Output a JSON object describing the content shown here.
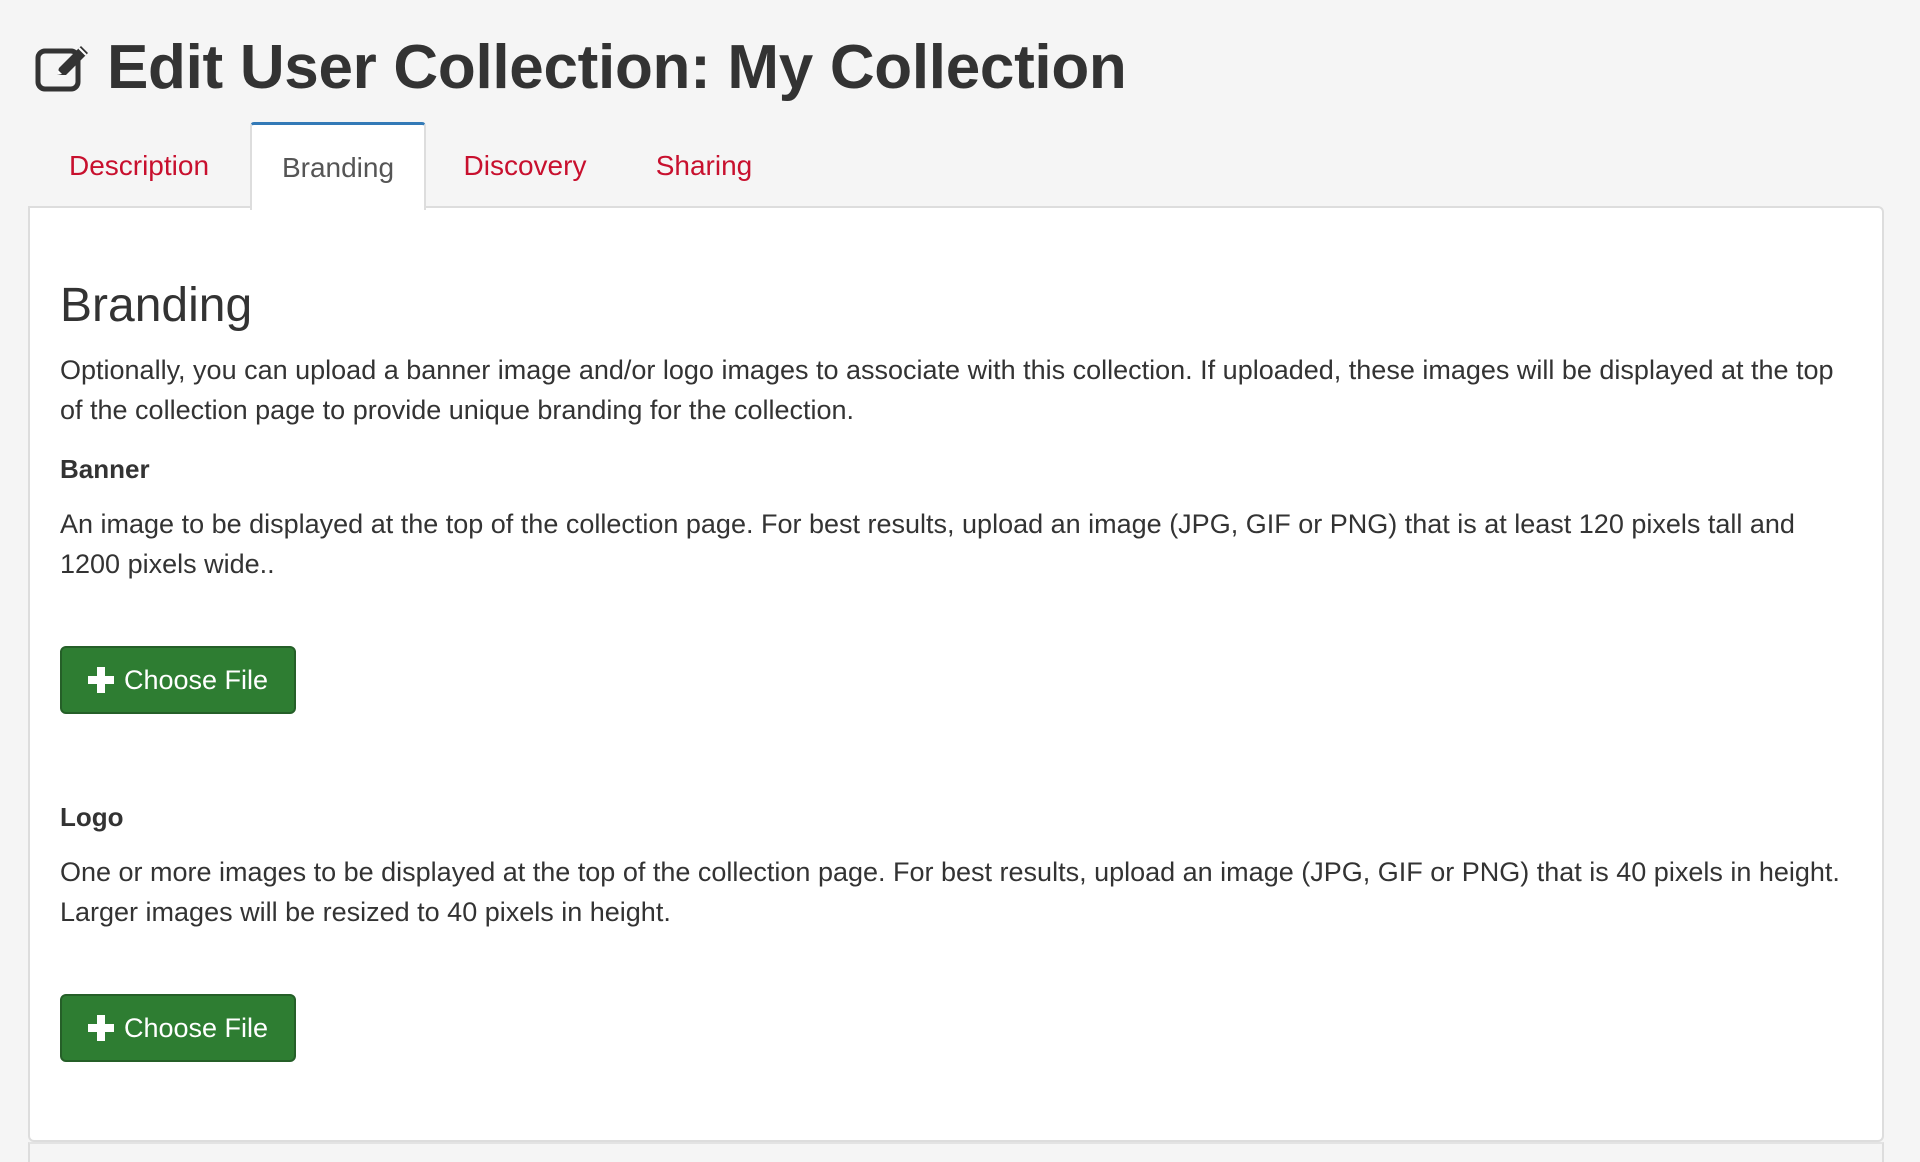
{
  "header": {
    "title": "Edit User Collection: My Collection",
    "icon": "edit-icon"
  },
  "tabs": [
    {
      "label": "Description",
      "active": false
    },
    {
      "label": "Branding",
      "active": true
    },
    {
      "label": "Discovery",
      "active": false
    },
    {
      "label": "Sharing",
      "active": false
    }
  ],
  "branding": {
    "title": "Branding",
    "intro": "Optionally, you can upload a banner image and/or logo images to associate with this collection. If uploaded, these images will be displayed at the top of the collection page to provide unique branding for the collection.",
    "banner": {
      "label": "Banner",
      "description": "An image to be displayed at the top of the collection page. For best results, upload an image (JPG, GIF or PNG) that is at least 120 pixels tall and 1200 pixels wide..",
      "button_label": "Choose File"
    },
    "logo": {
      "label": "Logo",
      "description": "One or more images to be displayed at the top of the collection page. For best results, upload an image (JPG, GIF or PNG) that is 40 pixels in height. Larger images will be resized to 40 pixels in height.",
      "button_label": "Choose File"
    }
  },
  "colors": {
    "tab_link": "#c8102e",
    "active_tab_top": "#337ab7",
    "button_green": "#2e7d32",
    "page_background": "#f5f5f5"
  }
}
